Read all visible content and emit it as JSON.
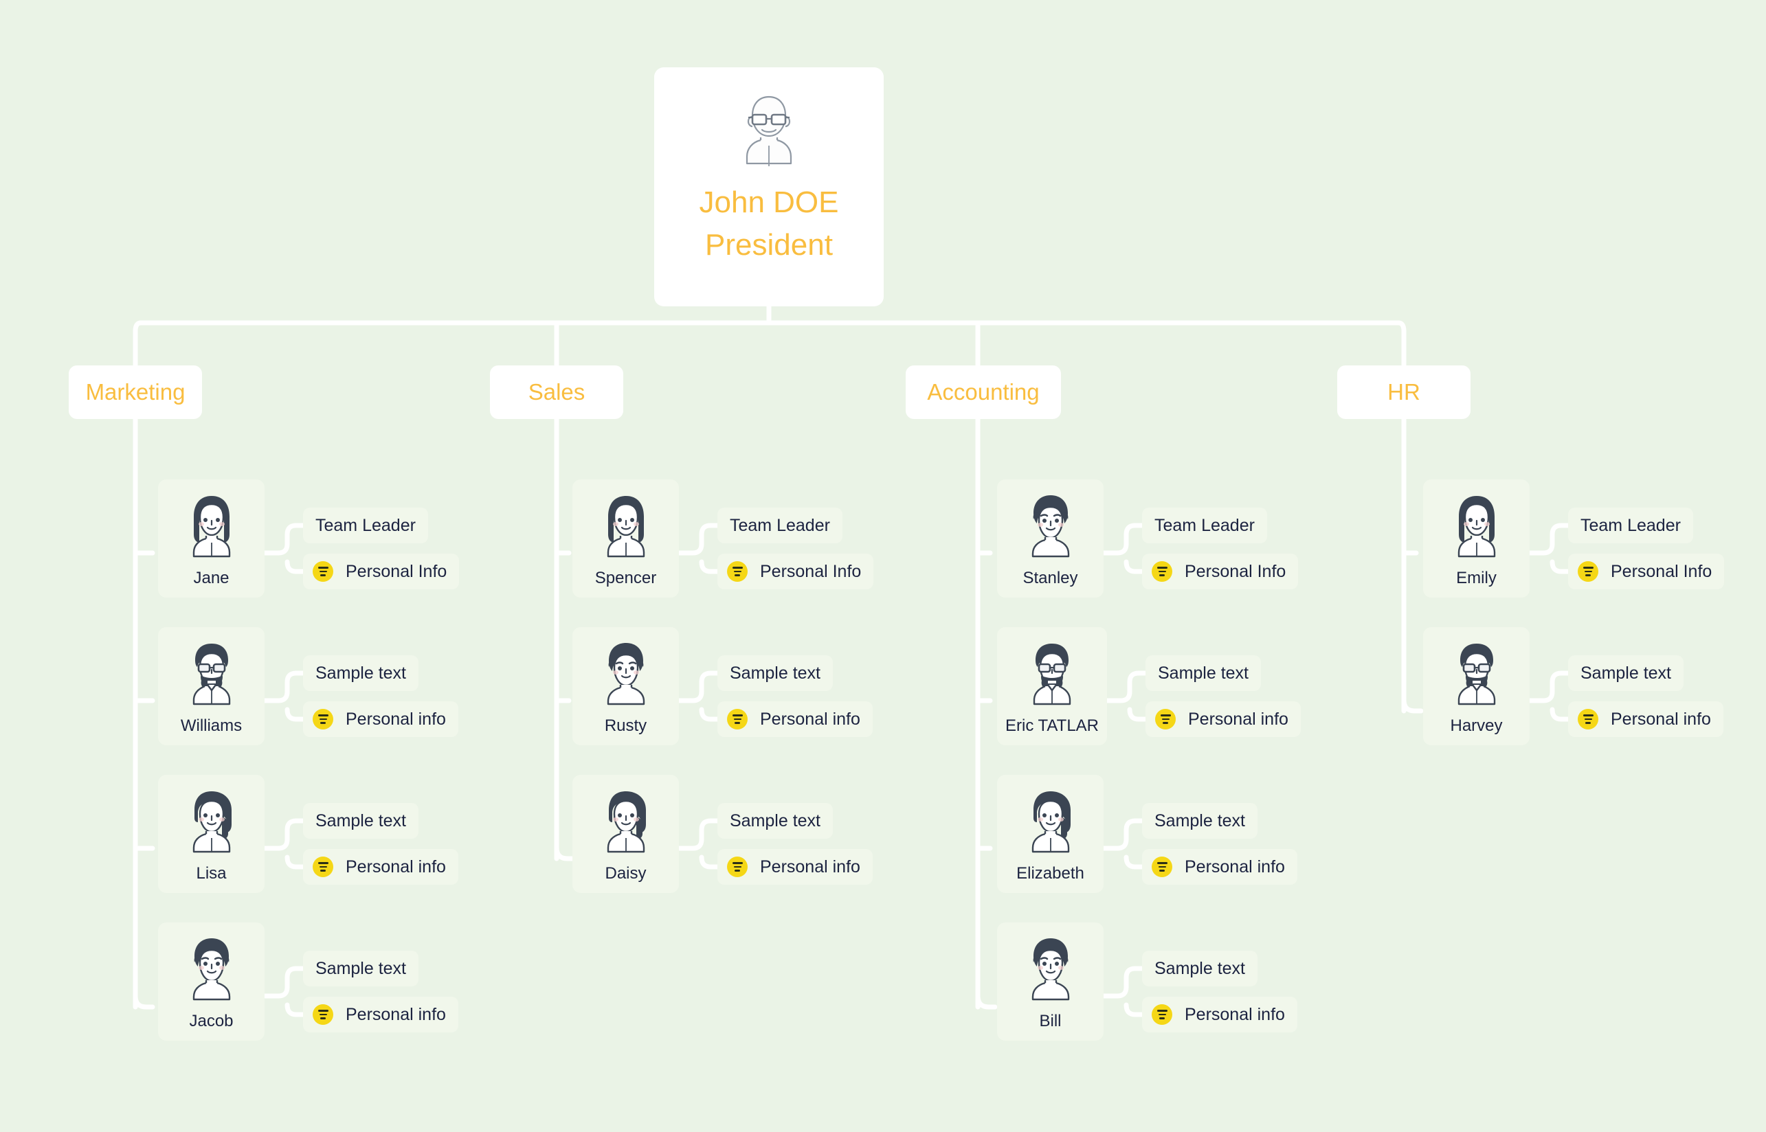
{
  "theme": {
    "page_background": "#eaf3e6",
    "card_background": "#ffffff",
    "node_background": "#f1f7eb",
    "accent_orange": "#f9bd3f",
    "text_dark": "#1c2340",
    "badge_yellow": "#f5d716",
    "connector_white": "#ffffff",
    "avatar_dark": "#3b4553"
  },
  "root": {
    "name": "John DOE",
    "title": "President",
    "avatar_icon": "bald-man-with-glasses-avatar"
  },
  "departments": [
    {
      "label": "Marketing"
    },
    {
      "label": "Sales"
    },
    {
      "label": "Accounting"
    },
    {
      "label": "HR"
    }
  ],
  "people": {
    "marketing": [
      {
        "name": "Jane",
        "role": "Team Leader",
        "info": "Personal Info",
        "avatar_icon": "woman-long-hair-avatar"
      },
      {
        "name": "Williams",
        "role": "Sample text",
        "info": "Personal info",
        "avatar_icon": "man-beard-glasses-avatar"
      },
      {
        "name": "Lisa",
        "role": "Sample text",
        "info": "Personal info",
        "avatar_icon": "woman-ponytail-avatar"
      },
      {
        "name": "Jacob",
        "role": "Sample text",
        "info": "Personal info",
        "avatar_icon": "man-curly-hair-avatar"
      }
    ],
    "sales": [
      {
        "name": "Spencer",
        "role": "Team Leader",
        "info": "Personal Info",
        "avatar_icon": "woman-long-hair-avatar"
      },
      {
        "name": "Rusty",
        "role": "Sample text",
        "info": "Personal info",
        "avatar_icon": "man-curly-hair-avatar"
      },
      {
        "name": "Daisy",
        "role": "Sample text",
        "info": "Personal info",
        "avatar_icon": "woman-ponytail-avatar"
      }
    ],
    "accounting": [
      {
        "name": "Stanley",
        "role": "Team Leader",
        "info": "Personal Info",
        "avatar_icon": "man-curly-hair-avatar"
      },
      {
        "name": "Eric TATLAR",
        "role": "Sample text",
        "info": "Personal info",
        "avatar_icon": "man-beard-glasses-avatar"
      },
      {
        "name": "Elizabeth",
        "role": "Sample text",
        "info": "Personal info",
        "avatar_icon": "woman-ponytail-avatar"
      },
      {
        "name": "Bill",
        "role": "Sample text",
        "info": "Personal info",
        "avatar_icon": "man-curly-hair-avatar"
      }
    ],
    "hr": [
      {
        "name": "Emily",
        "role": "Team Leader",
        "info": "Personal Info",
        "avatar_icon": "woman-long-hair-avatar"
      },
      {
        "name": "Harvey",
        "role": "Sample text",
        "info": "Personal info",
        "avatar_icon": "man-beard-glasses-avatar"
      }
    ]
  }
}
